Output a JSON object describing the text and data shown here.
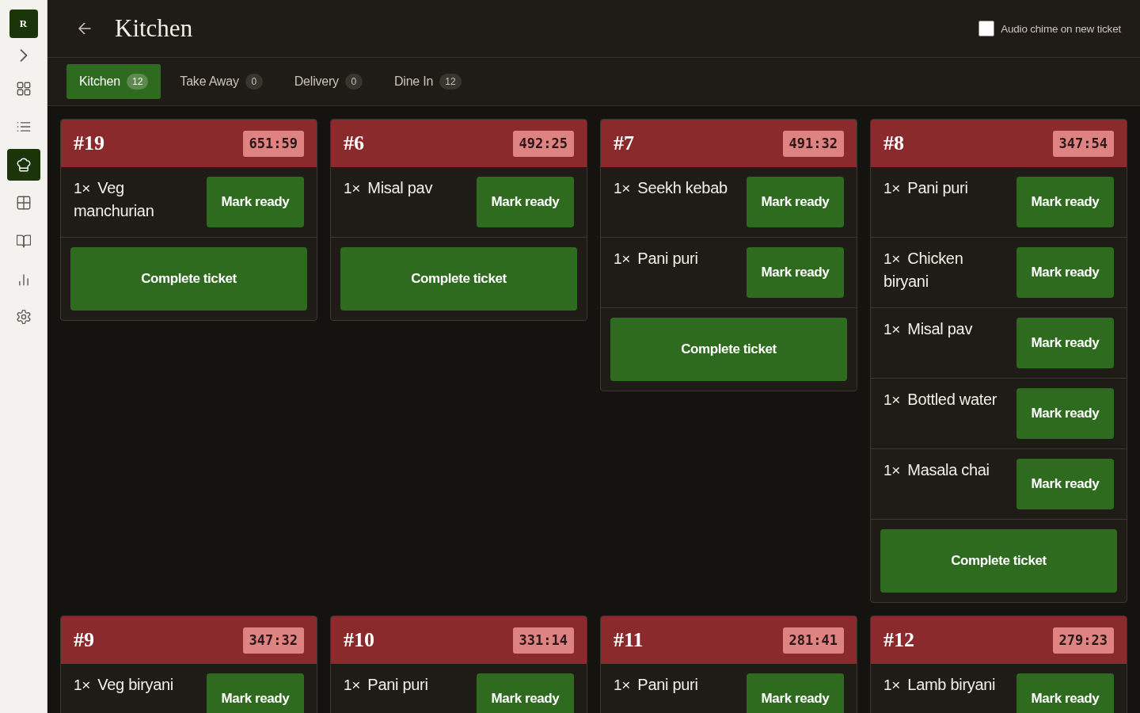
{
  "sidebar": {
    "logo": "R",
    "items": [
      {
        "kind": "grid",
        "selected": false
      },
      {
        "kind": "list",
        "selected": false
      },
      {
        "kind": "chef-hat",
        "selected": true
      },
      {
        "kind": "table",
        "selected": false
      },
      {
        "kind": "book",
        "selected": false
      },
      {
        "kind": "chart",
        "selected": false
      },
      {
        "kind": "settings",
        "selected": false
      }
    ]
  },
  "header": {
    "title": "Kitchen",
    "chime": {
      "label": "Audio chime on new ticket",
      "checked": false
    }
  },
  "tabs": [
    {
      "label": "Kitchen",
      "count": "12",
      "selected": true
    },
    {
      "label": "Take Away",
      "count": "0",
      "selected": false
    },
    {
      "label": "Delivery",
      "count": "0",
      "selected": false
    },
    {
      "label": "Dine In",
      "count": "12",
      "selected": false
    }
  ],
  "tickets": [
    {
      "number": "#19",
      "timer": "651:59",
      "items": [
        {
          "quantity": "1×",
          "name": "Veg manchurian",
          "action": "Mark ready"
        }
      ],
      "complete_button": "Complete ticket"
    },
    {
      "number": "#6",
      "timer": "492:25",
      "items": [
        {
          "quantity": "1×",
          "name": "Misal pav",
          "action": "Mark ready"
        }
      ],
      "complete_button": "Complete ticket"
    },
    {
      "number": "#7",
      "timer": "491:32",
      "items": [
        {
          "quantity": "1×",
          "name": "Seekh kebab",
          "action": "Mark ready"
        },
        {
          "quantity": "1×",
          "name": "Pani puri",
          "action": "Mark ready"
        }
      ],
      "complete_button": "Complete ticket"
    },
    {
      "number": "#8",
      "timer": "347:54",
      "items": [
        {
          "quantity": "1×",
          "name": "Pani puri",
          "action": "Mark ready"
        },
        {
          "quantity": "1×",
          "name": "Chicken biryani",
          "action": "Mark ready"
        },
        {
          "quantity": "1×",
          "name": "Misal pav",
          "action": "Mark ready"
        },
        {
          "quantity": "1×",
          "name": "Bottled water",
          "action": "Mark ready"
        },
        {
          "quantity": "1×",
          "name": "Masala chai",
          "action": "Mark ready"
        }
      ],
      "complete_button": "Complete ticket"
    },
    {
      "number": "#9",
      "timer": "347:32",
      "items": [
        {
          "quantity": "1×",
          "name": "Veg biryani",
          "action": "Mark ready"
        }
      ]
    },
    {
      "number": "#10",
      "timer": "331:14",
      "items": [
        {
          "quantity": "1×",
          "name": "Pani puri",
          "action": "Mark ready"
        }
      ]
    },
    {
      "number": "#11",
      "timer": "281:41",
      "items": [
        {
          "quantity": "1×",
          "name": "Pani puri",
          "action": "Mark ready"
        }
      ]
    },
    {
      "number": "#12",
      "timer": "279:23",
      "items": [
        {
          "quantity": "1×",
          "name": "Lamb biryani",
          "action": "Mark ready"
        }
      ]
    }
  ]
}
